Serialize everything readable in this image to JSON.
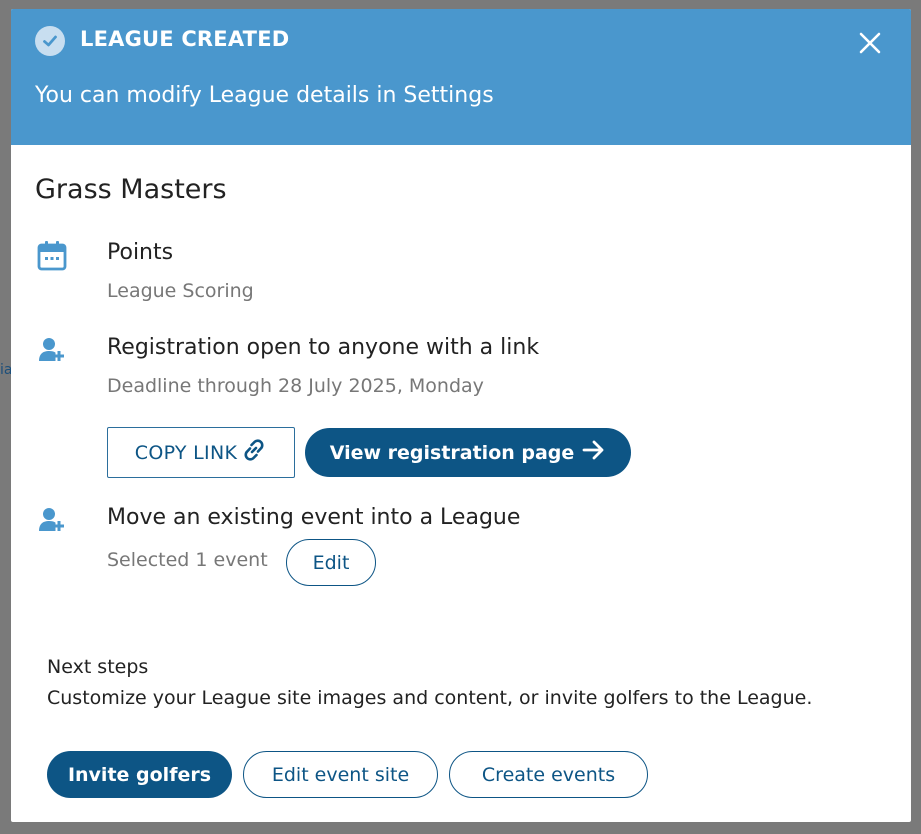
{
  "background": {
    "stub_text": "ia"
  },
  "banner": {
    "title": "LEAGUE CREATED",
    "subtitle": "You can modify League details in Settings",
    "check_icon": "check-circle-icon",
    "close_icon": "close-icon"
  },
  "league": {
    "name": "Grass Masters"
  },
  "scoring": {
    "title": "Points",
    "subtitle": "League Scoring",
    "icon": "calendar-icon"
  },
  "registration": {
    "title": "Registration open to anyone with a link",
    "subtitle": "Deadline through 28 July 2025, Monday",
    "icon": "add-user-icon",
    "copy_link_label": "COPY LINK",
    "view_page_label": "View registration page"
  },
  "existing_event": {
    "title": "Move an existing event into a League",
    "selected_text": "Selected 1 event",
    "edit_label": "Edit",
    "icon": "add-user-icon"
  },
  "next_steps": {
    "title": "Next steps",
    "body": "Customize your League site images and content, or invite golfers to the League.",
    "buttons": {
      "invite": "Invite golfers",
      "edit_site": "Edit event site",
      "create_events": "Create events"
    }
  },
  "colors": {
    "banner": "#4a97cd",
    "primary": "#0d5585",
    "icon": "#4a97cd"
  }
}
